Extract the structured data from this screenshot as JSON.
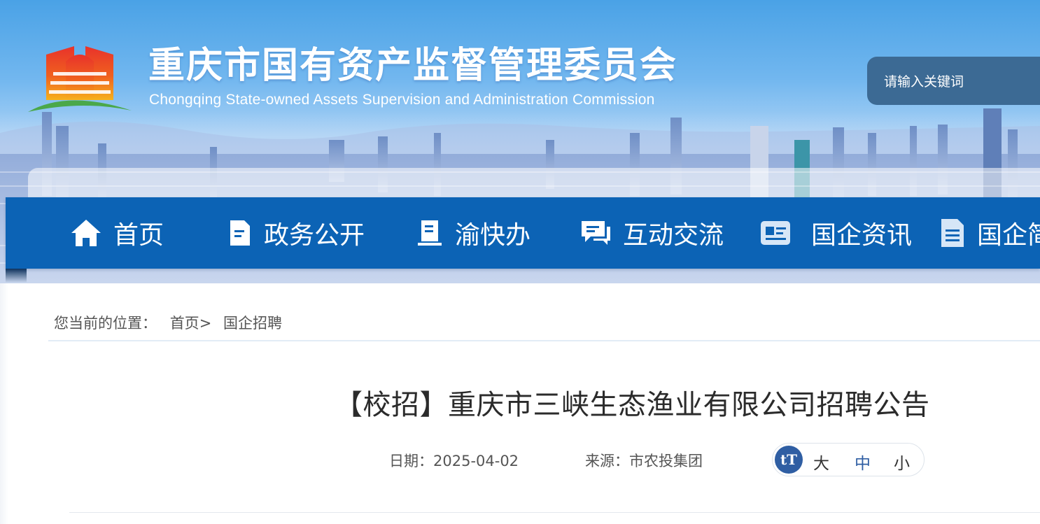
{
  "header": {
    "site_title": "重庆市国有资产监督管理委员会",
    "site_subtitle": "Chongqing State-owned Assets Supervision and Administration Commission",
    "search_placeholder": "请输入关键词"
  },
  "nav": {
    "items": [
      {
        "label": "首页",
        "icon": "home-icon"
      },
      {
        "label": "政务公开",
        "icon": "document-icon"
      },
      {
        "label": "渝快办",
        "icon": "book-icon"
      },
      {
        "label": "互动交流",
        "icon": "chat-icon"
      },
      {
        "label": "国企资讯",
        "icon": "id-card-icon"
      },
      {
        "label": "国企简",
        "icon": "file-icon"
      }
    ]
  },
  "breadcrumb": {
    "prefix": "您当前的位置：",
    "home": "首页",
    "separator": ">",
    "current": "国企招聘"
  },
  "article": {
    "title": "【校招】重庆市三峡生态渔业有限公司招聘公告",
    "date": "日期：2025-04-02",
    "source": "来源：市农投集团"
  },
  "font_size": {
    "icon_text": "tT",
    "large": "大",
    "medium": "中",
    "small": "小"
  },
  "colors": {
    "nav_bg": "#0c63b5",
    "search_bg": "#3c6a94",
    "font_icon_bg": "#2f5ea3",
    "medium_active": "#2f5ea3"
  }
}
